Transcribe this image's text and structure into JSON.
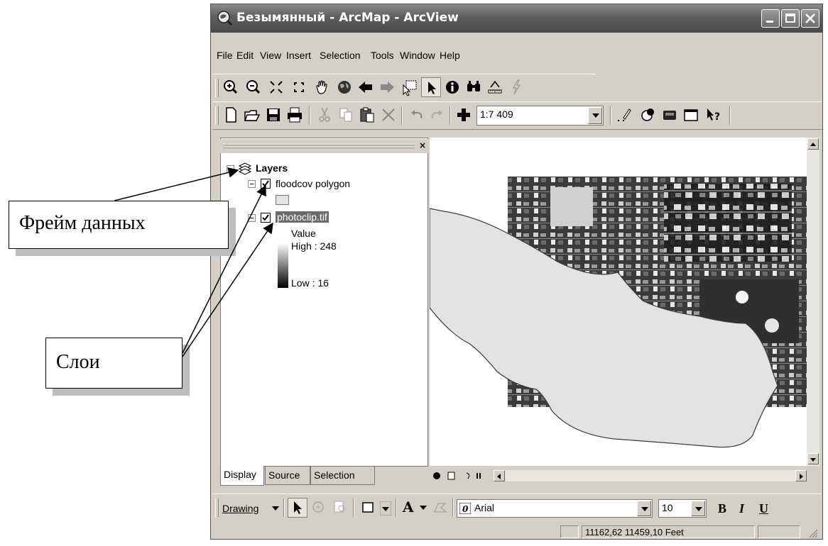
{
  "window": {
    "title": "Безымянный - ArcMap - ArcView"
  },
  "menu": [
    "File",
    "Edit",
    "View",
    "Insert",
    "Selection",
    "Tools",
    "Window",
    "Help"
  ],
  "toolbar": {
    "scale_value": "1:7 409"
  },
  "toc": {
    "data_frame": "Layers",
    "layer1": {
      "name": "floodcov polygon",
      "checked": true
    },
    "layer2": {
      "name": "photoclip.tif",
      "checked": true,
      "legend_title": "Value",
      "high": "High : 248",
      "low": "Low : 16"
    },
    "tabs": [
      "Display",
      "Source",
      "Selection"
    ]
  },
  "drawing_toolbar": {
    "drawing_label": "Drawing",
    "font": "Arial",
    "size": "10",
    "bold": "B",
    "italic": "I",
    "underline": "U"
  },
  "status": {
    "coordinates": "11162,62  11459,10 Feet"
  },
  "annotations": {
    "data_frame_label": "Фрейм данных",
    "layers_label": "Слои"
  },
  "colors": {
    "titlebar": "#5e5e5e",
    "window_bg": "#d4d0c8",
    "polygon_fill": "#e3e3e3",
    "selection_highlight": "#6b6b6b"
  }
}
